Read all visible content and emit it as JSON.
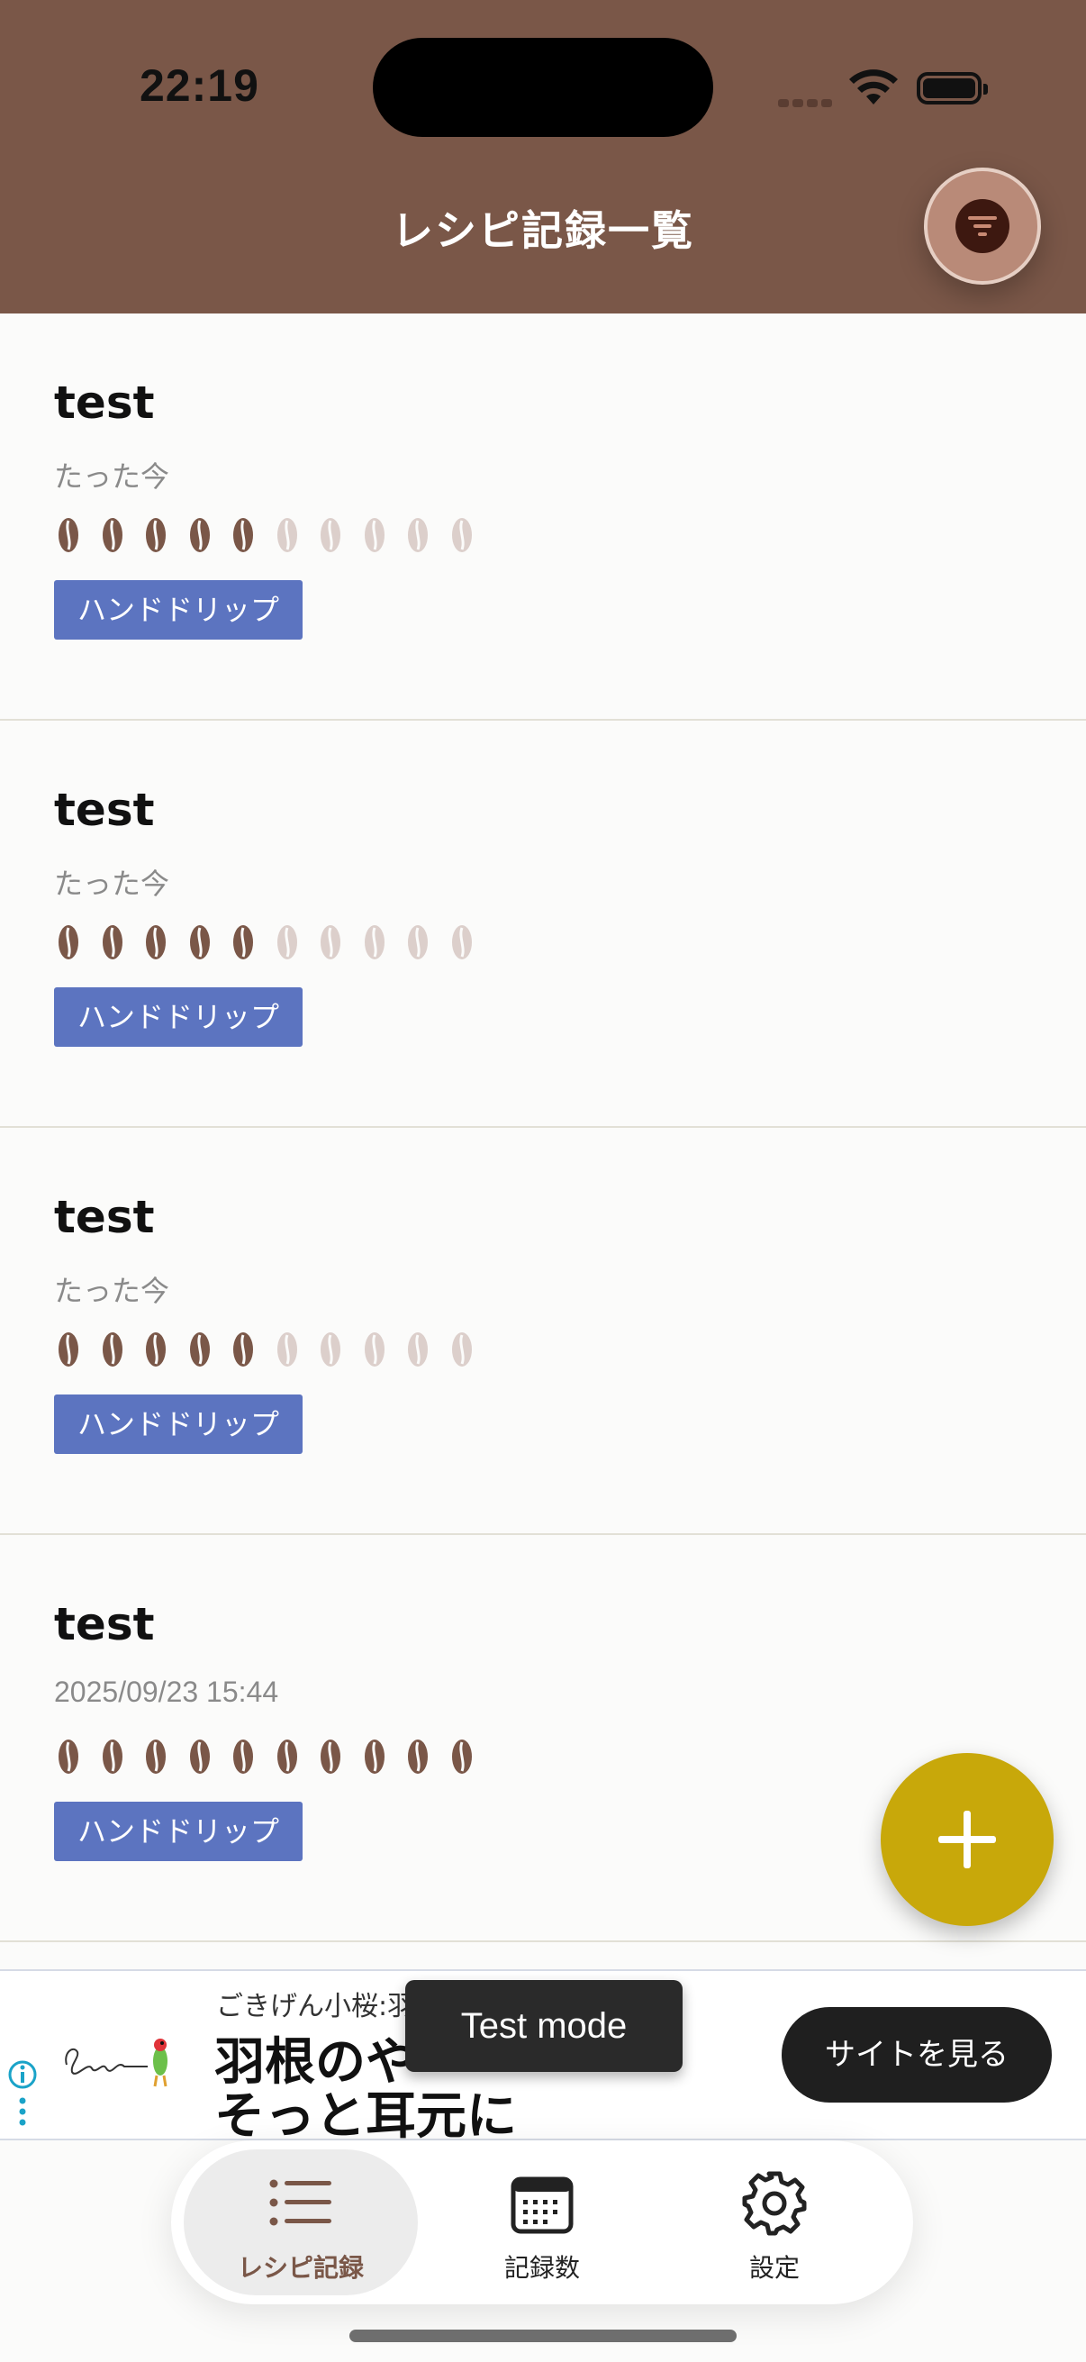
{
  "status": {
    "time": "22:19"
  },
  "header": {
    "title": "レシピ記録一覧"
  },
  "records": [
    {
      "title": "test",
      "date": "たった今",
      "rating": 5,
      "max_rating": 10,
      "tag": "ハンドドリップ"
    },
    {
      "title": "test",
      "date": "たった今",
      "rating": 5,
      "max_rating": 10,
      "tag": "ハンドドリップ"
    },
    {
      "title": "test",
      "date": "たった今",
      "rating": 5,
      "max_rating": 10,
      "tag": "ハンドドリップ"
    },
    {
      "title": "test",
      "date": "2025/09/23 15:44",
      "rating": 10,
      "max_rating": 10,
      "tag": "ハンドドリップ"
    }
  ],
  "ad": {
    "advertiser": "ごきげん小桜:羽",
    "headline_1": "羽根のや",
    "headline_2": "そっと耳元に",
    "cta": "サイトを見る",
    "test_mode": "Test mode"
  },
  "tabs": [
    {
      "label": "レシピ記録",
      "icon": "list-icon",
      "active": true
    },
    {
      "label": "記録数",
      "icon": "calendar-icon",
      "active": false
    },
    {
      "label": "設定",
      "icon": "gear-icon",
      "active": false
    }
  ],
  "colors": {
    "header": "#7a5748",
    "bean_filled": "#7a5748",
    "bean_empty": "#dccfcb",
    "tag": "#5c74c0",
    "fab": "#c8a80a"
  }
}
